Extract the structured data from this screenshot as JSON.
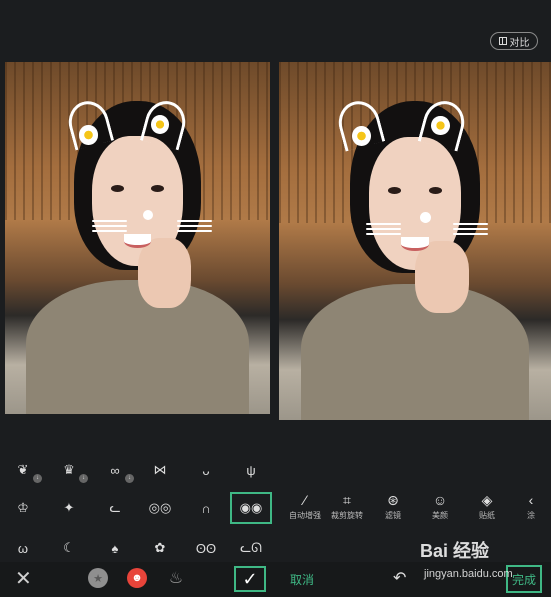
{
  "header": {
    "compare_label": "对比"
  },
  "stickers": [
    {
      "icon": "antler-crown",
      "badge": "↓"
    },
    {
      "icon": "pink-crown",
      "badge": "↓"
    },
    {
      "icon": "glasses",
      "badge": "↓"
    },
    {
      "icon": "gold-bow",
      "badge": ""
    },
    {
      "icon": "bunny-ears",
      "badge": ""
    },
    {
      "icon": "deer-horns",
      "badge": ""
    },
    {
      "icon": "tiara",
      "badge": ""
    },
    {
      "icon": "crown-sparkle",
      "badge": ""
    },
    {
      "icon": "neon-cute",
      "badge": ""
    },
    {
      "icon": "round-glasses",
      "badge": ""
    },
    {
      "icon": "rabbit-ears",
      "badge": ""
    },
    {
      "icon": "cat-face",
      "badge": "",
      "selected": true
    },
    {
      "icon": "cat-mask",
      "badge": ""
    },
    {
      "icon": "banana",
      "badge": ""
    },
    {
      "icon": "mushroom",
      "badge": ""
    },
    {
      "icon": "bunny-head",
      "badge": ""
    },
    {
      "icon": "panda",
      "badge": ""
    },
    {
      "icon": "white-cat",
      "badge": ""
    }
  ],
  "tools": [
    {
      "label": "自动增强",
      "icon": "magic-wand-icon"
    },
    {
      "label": "裁剪旋转",
      "icon": "crop-icon"
    },
    {
      "label": "滤镜",
      "icon": "filter-icon"
    },
    {
      "label": "美颜",
      "icon": "beauty-icon"
    },
    {
      "label": "贴纸",
      "icon": "sticker-icon"
    },
    {
      "label": "涂",
      "icon": "brush-icon"
    }
  ],
  "bottom": {
    "cancel_label": "取消",
    "done_label": "完成"
  },
  "watermark": {
    "brand": "Bai 经验",
    "url": "jingyan.baidu.com"
  }
}
